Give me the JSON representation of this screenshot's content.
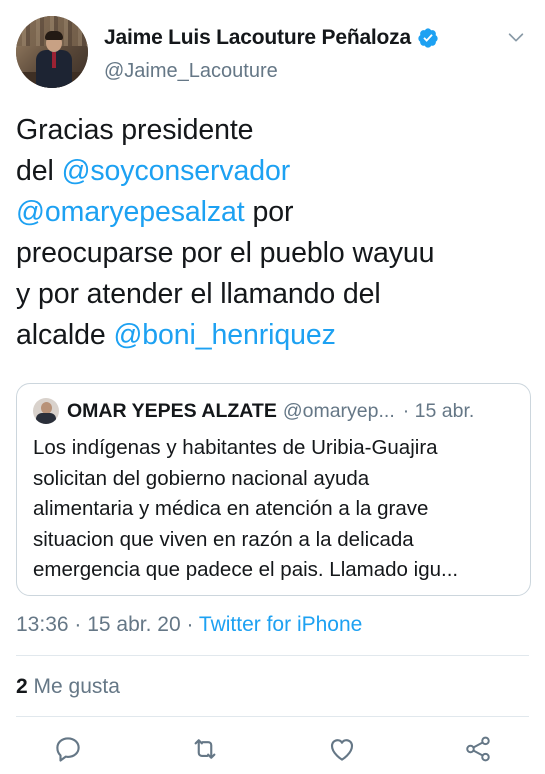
{
  "author": {
    "display_name": "Jaime Luis Lacouture Peñaloza",
    "handle": "@Jaime_Lacouture",
    "verified": true
  },
  "tweet": {
    "text_lines": [
      [
        "Gracias presidente"
      ],
      [
        "del ",
        "@soyconservador"
      ],
      [
        "@omaryepesalzat",
        " por"
      ],
      [
        "preocuparse por el pueblo wayuu"
      ],
      [
        "y por atender el llamando del"
      ],
      [
        "alcalde ",
        "@boni_henriquez"
      ]
    ],
    "line1": "Gracias presidente",
    "line2_text": "del ",
    "line2_mention": "@soyconservador",
    "line3_mention": "@omaryepesalzat",
    "line3_text": " por",
    "line4": "preocuparse por el pueblo wayuu",
    "line5": "y por atender el llamando del",
    "line6_text": "alcalde ",
    "line6_mention": "@boni_henriquez"
  },
  "quote": {
    "name": "OMAR YEPES ALZATE",
    "handle": "@omaryep...",
    "date": "· 15 abr.",
    "body_lines": {
      "l1": "Los indígenas y habitantes de Uribia-Guajira",
      "l2": "solicitan del gobierno nacional ayuda",
      "l3": "alimentaria y médica en atención a la grave",
      "l4": "situacion que viven en razón a la delicada",
      "l5": "emergencia que padece el pais. Llamado igu..."
    }
  },
  "meta": {
    "time_date": "13:36 · 15 abr. 20 · ",
    "source": "Twitter for iPhone"
  },
  "engagement": {
    "likes_count": "2",
    "likes_label": " Me gusta"
  },
  "actions": {
    "icons": [
      "reply-icon",
      "retweet-icon",
      "like-icon",
      "share-icon"
    ]
  },
  "colors": {
    "accent": "#1da1f2",
    "text": "#14171a",
    "secondary": "#657786",
    "border": "#ccd6dd"
  }
}
